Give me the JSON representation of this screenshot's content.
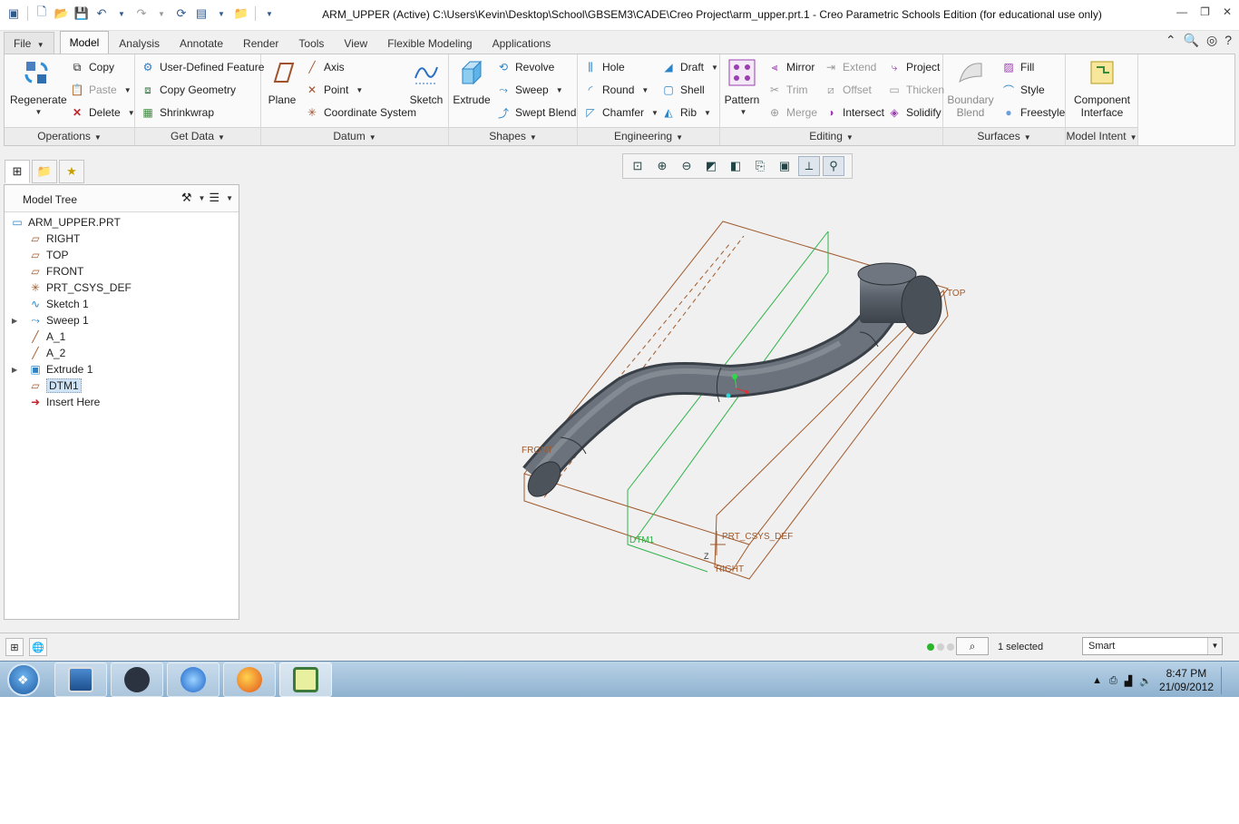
{
  "window": {
    "title": "ARM_UPPER (Active) C:\\Users\\Kevin\\Desktop\\School\\GBSEM3\\CADE\\Creo Project\\arm_upper.prt.1 - Creo Parametric Schools Edition (for educational use only)"
  },
  "tabs": {
    "file": "File",
    "items": [
      "Model",
      "Analysis",
      "Annotate",
      "Render",
      "Tools",
      "View",
      "Flexible Modeling",
      "Applications"
    ]
  },
  "ribbon": {
    "operations": {
      "label": "Operations",
      "regenerate": "Regenerate",
      "copy": "Copy",
      "paste": "Paste",
      "delete": "Delete"
    },
    "getdata": {
      "label": "Get Data",
      "udf": "User-Defined Feature",
      "copy_geometry": "Copy Geometry",
      "shrinkwrap": "Shrinkwrap"
    },
    "datum": {
      "label": "Datum",
      "plane": "Plane",
      "axis": "Axis",
      "point": "Point",
      "csys": "Coordinate System",
      "sketch": "Sketch"
    },
    "shapes": {
      "label": "Shapes",
      "extrude": "Extrude",
      "revolve": "Revolve",
      "sweep": "Sweep",
      "swept_blend": "Swept Blend"
    },
    "engineering": {
      "label": "Engineering",
      "hole": "Hole",
      "round": "Round",
      "chamfer": "Chamfer",
      "draft": "Draft",
      "shell": "Shell",
      "rib": "Rib"
    },
    "editing": {
      "label": "Editing",
      "pattern": "Pattern",
      "mirror": "Mirror",
      "trim": "Trim",
      "merge": "Merge",
      "extend": "Extend",
      "offset": "Offset",
      "intersect": "Intersect",
      "project": "Project",
      "thicken": "Thicken",
      "solidify": "Solidify"
    },
    "surfaces": {
      "label": "Surfaces",
      "boundary_blend_1": "Boundary",
      "boundary_blend_2": "Blend",
      "fill": "Fill",
      "style": "Style",
      "freestyle": "Freestyle"
    },
    "model_intent": {
      "label": "Model Intent",
      "component_interface_1": "Component",
      "component_interface_2": "Interface"
    }
  },
  "model_tree": {
    "title": "Model Tree",
    "items": [
      {
        "label": "ARM_UPPER.PRT",
        "icon": "part-icon"
      },
      {
        "label": "RIGHT",
        "icon": "datum-plane-icon"
      },
      {
        "label": "TOP",
        "icon": "datum-plane-icon"
      },
      {
        "label": "FRONT",
        "icon": "datum-plane-icon"
      },
      {
        "label": "PRT_CSYS_DEF",
        "icon": "csys-icon"
      },
      {
        "label": "Sketch 1",
        "icon": "sketch-icon"
      },
      {
        "label": "Sweep 1",
        "icon": "sweep-icon"
      },
      {
        "label": "A_1",
        "icon": "datum-axis-icon"
      },
      {
        "label": "A_2",
        "icon": "datum-axis-icon"
      },
      {
        "label": "Extrude 1",
        "icon": "extrude-icon"
      },
      {
        "label": "DTM1",
        "icon": "datum-plane-icon"
      },
      {
        "label": "Insert Here",
        "icon": "insert-arrow-icon"
      }
    ]
  },
  "graphics": {
    "labels": {
      "front": "FRONT",
      "top": "TOP",
      "right": "RIGHT",
      "csys": "PRT_CSYS_DEF",
      "dtm1": "DTM1",
      "z": "Z"
    },
    "colors": {
      "datum_plane": "#a05a2c",
      "selected_plane": "#2fb34a",
      "part": "#5f6670"
    }
  },
  "statusbar": {
    "selected": "1 selected",
    "filter": "Smart"
  },
  "taskbar": {
    "time": "8:47 PM",
    "date": "21/09/2012"
  }
}
